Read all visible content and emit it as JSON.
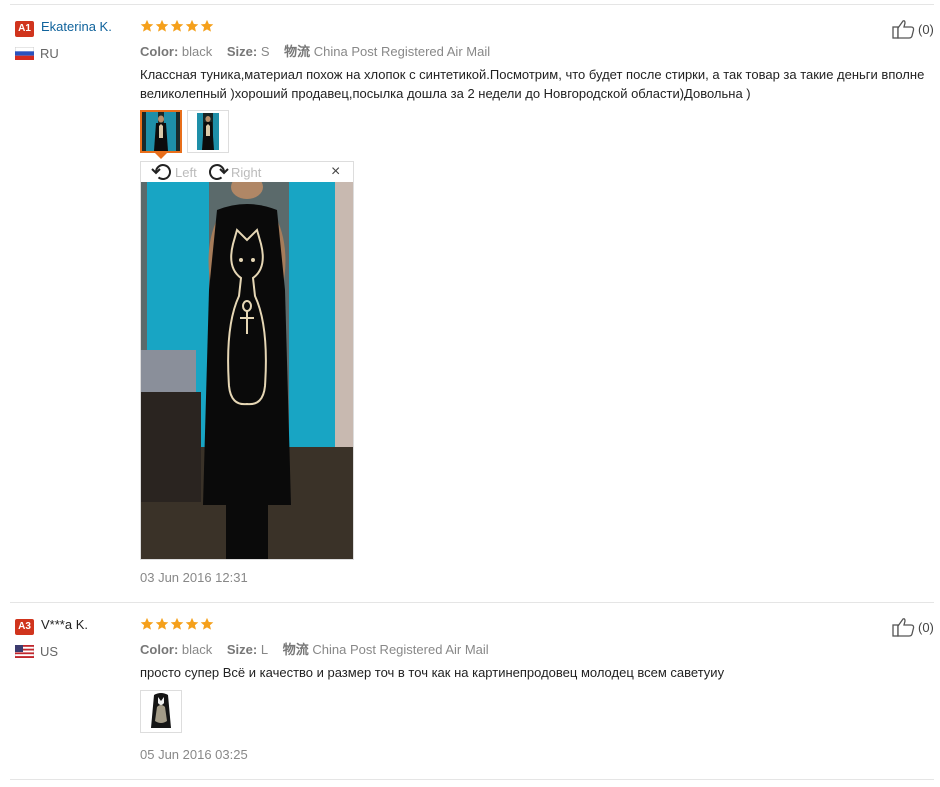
{
  "reviews": [
    {
      "badge": "A1",
      "name": "Ekaterina K.",
      "country": "RU",
      "rating": 5,
      "color_label": "Color:",
      "color_value": "black",
      "size_label": "Size:",
      "size_value": "S",
      "shipping_label": "物流",
      "shipping_value": "China Post Registered Air Mail",
      "text": "Классная туника,материал похож на хлопок с синтетикой.Посмотрим, что будет после стирки, а так товар за такие деньги вполне великолепный )хороший продавец,посылка дошла за 2 недели до Новгородской области)Довольна )",
      "viewer": {
        "left_label": "Left",
        "right_label": "Right",
        "close": "×"
      },
      "date": "03 Jun 2016 12:31",
      "likes": "(0)"
    },
    {
      "badge": "A3",
      "name": "V***a K.",
      "country": "US",
      "rating": 5,
      "color_label": "Color:",
      "color_value": "black",
      "size_label": "Size:",
      "size_value": "L",
      "shipping_label": "物流",
      "shipping_value": "China Post Registered Air Mail",
      "text": "просто супер Всё и качество и размер точ в точ как на картинепродовец молодец всем саветуиу",
      "date": "05 Jun 2016 03:25",
      "likes": "(0)"
    }
  ],
  "colors": {
    "badge": "#d0341d",
    "star": "#f5a01b",
    "link": "#10639c",
    "active_thumb": "#e86e1a"
  }
}
